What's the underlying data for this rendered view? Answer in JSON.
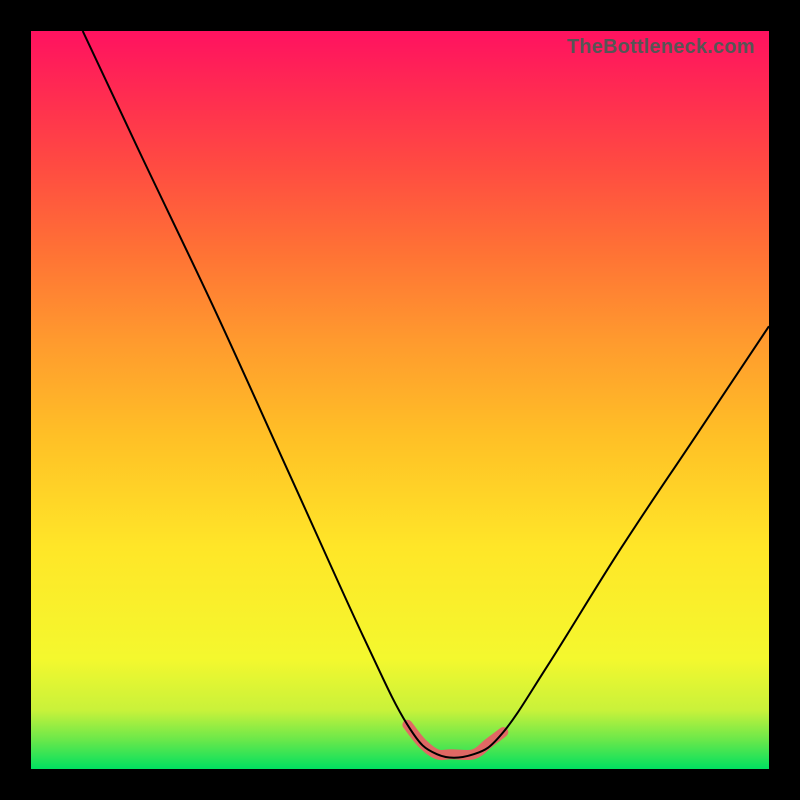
{
  "watermark": "TheBottleneck.com",
  "colors": {
    "black_border": "#000000",
    "curve": "#000000",
    "highlight": "#e06864",
    "gradient_top": "#ff1260",
    "gradient_bottom": "#00e060"
  },
  "chart_data": {
    "type": "line",
    "title": "",
    "xlabel": "",
    "ylabel": "",
    "xlim": [
      0,
      100
    ],
    "ylim": [
      0,
      100
    ],
    "series": [
      {
        "name": "bottleneck-curve",
        "x": [
          7,
          15,
          25,
          35,
          45,
          51,
          55,
          60,
          64,
          70,
          80,
          90,
          100
        ],
        "values": [
          100,
          83,
          62,
          40,
          18,
          6,
          2,
          2,
          5,
          14,
          30,
          45,
          60
        ]
      }
    ],
    "highlight_region": {
      "note": "points along the curve around its minimum, drawn thick in red",
      "x": [
        51,
        53,
        55,
        57,
        60,
        62,
        64
      ],
      "values": [
        6,
        3.5,
        2,
        2,
        2,
        3.5,
        5
      ]
    }
  }
}
